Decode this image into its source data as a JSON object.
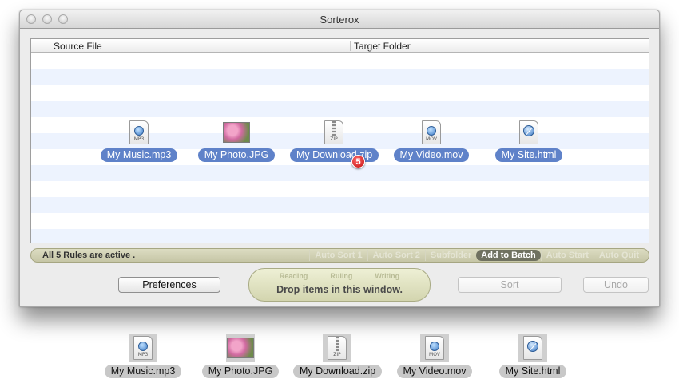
{
  "window": {
    "title": "Sorterox",
    "columns": [
      "Source File",
      "Target Folder"
    ]
  },
  "drag_items": [
    {
      "label": "My Music.mp3",
      "icon": "mp3-file-icon",
      "tag": "MP3"
    },
    {
      "label": "My Photo.JPG",
      "icon": "photo-thumbnail-icon",
      "tag": ""
    },
    {
      "label": "My Download.zip",
      "icon": "zip-file-icon",
      "tag": "ZIP"
    },
    {
      "label": "My Video.mov",
      "icon": "mov-file-icon",
      "tag": "MOV"
    },
    {
      "label": "My Site.html",
      "icon": "html-file-icon",
      "tag": ""
    }
  ],
  "drag_count_badge": "5",
  "status": {
    "text": "All 5 Rules are active .",
    "modes": [
      {
        "label": "Auto Sort 1",
        "active": false
      },
      {
        "label": "Auto Sort 2",
        "active": false
      },
      {
        "label": "Subfolder",
        "active": false
      },
      {
        "label": "Add to Batch",
        "active": true
      },
      {
        "label": "Auto Start",
        "active": false
      },
      {
        "label": "Auto Quit",
        "active": false
      }
    ]
  },
  "buttons": {
    "preferences": "Preferences",
    "sort": "Sort",
    "undo": "Undo"
  },
  "dropzone": {
    "phases": [
      "Reading",
      "Ruling",
      "Writing"
    ],
    "message": "Drop items in this window."
  },
  "desktop_files": [
    {
      "label": "My Music.mp3",
      "tag": "MP3"
    },
    {
      "label": "My Photo.JPG",
      "tag": ""
    },
    {
      "label": "My Download.zip",
      "tag": "ZIP"
    },
    {
      "label": "My Video.mov",
      "tag": "MOV"
    },
    {
      "label": "My Site.html",
      "tag": ""
    }
  ],
  "colors": {
    "selection": "#5f82c9",
    "stripe": "#edf3fe",
    "statusbar": "#c6c6a6",
    "active_mode": "#6f7160"
  }
}
